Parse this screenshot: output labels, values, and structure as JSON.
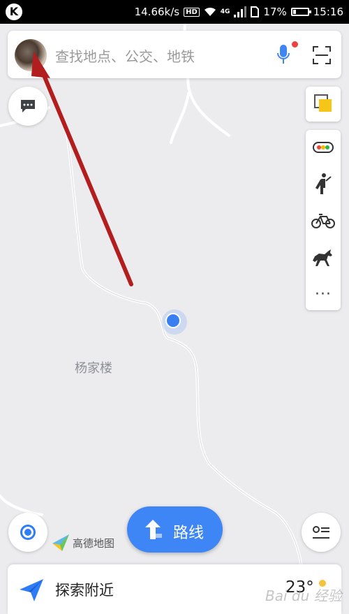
{
  "status_bar": {
    "logo": "K",
    "network_speed": "14.66k/s",
    "hd": "HD",
    "net_type": "4G",
    "battery": "17%",
    "time": "15:16"
  },
  "search": {
    "placeholder": "查找地点、公交、地铁",
    "mic_badge_color": "#f04141"
  },
  "map": {
    "place_label": "杨家楼"
  },
  "tools": {
    "more": "···"
  },
  "brand": {
    "name": "高德地图"
  },
  "route_button": {
    "label": "路线"
  },
  "explore": {
    "label": "探索附近",
    "temperature": "23°"
  },
  "watermark": "Bai du 经验",
  "colors": {
    "accent": "#3e86f6",
    "annotation_arrow": "#b21d1d"
  },
  "icons": [
    "message-icon",
    "layers-icon",
    "traffic-icon",
    "walk-icon",
    "bike-icon",
    "horse-icon",
    "more-icon",
    "locate-icon",
    "list-icon",
    "route-arrow-icon",
    "navigation-icon",
    "mic-icon",
    "scan-icon"
  ]
}
